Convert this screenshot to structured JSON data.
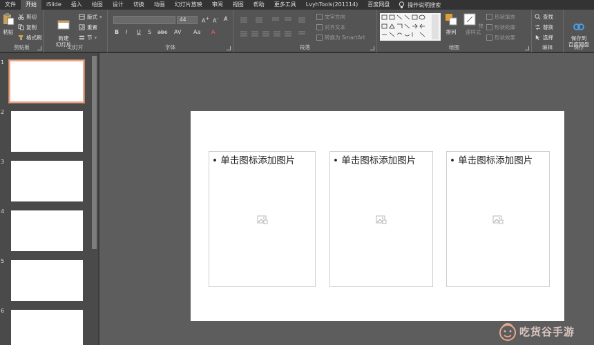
{
  "menu": {
    "tabs": [
      "文件",
      "开始",
      "iSlide",
      "插入",
      "绘图",
      "设计",
      "切换",
      "动画",
      "幻灯片放映",
      "审阅",
      "视图",
      "帮助",
      "更多工具",
      "LvyhTools(201114)",
      "百度网盘"
    ],
    "active_tab": "开始",
    "search_label": "操作说明搜索",
    "search_icon": "lightbulb-icon"
  },
  "ribbon": {
    "clipboard": {
      "label": "剪贴板",
      "paste": "粘贴",
      "cut": "剪切",
      "copy": "复制",
      "format_painter": "格式刷"
    },
    "slides": {
      "label": "幻灯片",
      "new_slide": "新建\n幻灯片",
      "layout": "版式",
      "reset": "重置",
      "section": "节"
    },
    "font": {
      "label": "字体",
      "font_name": "",
      "font_size": "44",
      "bold": "B",
      "italic": "I",
      "underline": "U",
      "shadow": "S",
      "strike": "abc",
      "spacing": "AV",
      "case": "Aa",
      "color": "A"
    },
    "paragraph": {
      "label": "段落",
      "text_direction": "文字方向",
      "align_text": "对齐文本",
      "convert_smartart": "转换为 SmartArt"
    },
    "drawing": {
      "label": "绘图",
      "arrange": "排列",
      "quick_styles": "快速样式",
      "shape_fill": "形状填充",
      "shape_outline": "形状轮廓",
      "shape_effects": "形状效果"
    },
    "editing": {
      "label": "编辑",
      "find": "查找",
      "replace": "替换",
      "select": "选择"
    },
    "save": {
      "label": "保存",
      "save_baidu": "保存到\n百度网盘"
    }
  },
  "thumbnails": [
    "1",
    "2",
    "3",
    "4",
    "5",
    "6"
  ],
  "selected_slide": "1",
  "slide": {
    "placeholders": [
      {
        "text": "单击图标添加图片",
        "icon": "picture-icon"
      },
      {
        "text": "单击图标添加图片",
        "icon": "picture-icon"
      },
      {
        "text": "单击图标添加图片",
        "icon": "picture-icon"
      }
    ]
  },
  "watermark": {
    "text": "吃货谷手游",
    "icon": "mascot-logo-icon"
  },
  "colors": {
    "ribbon": "#545454",
    "menubar": "#333333",
    "slide_bg": "#ffffff",
    "work_area": "#5d5d5d",
    "selected_border": "#e8a58a"
  }
}
